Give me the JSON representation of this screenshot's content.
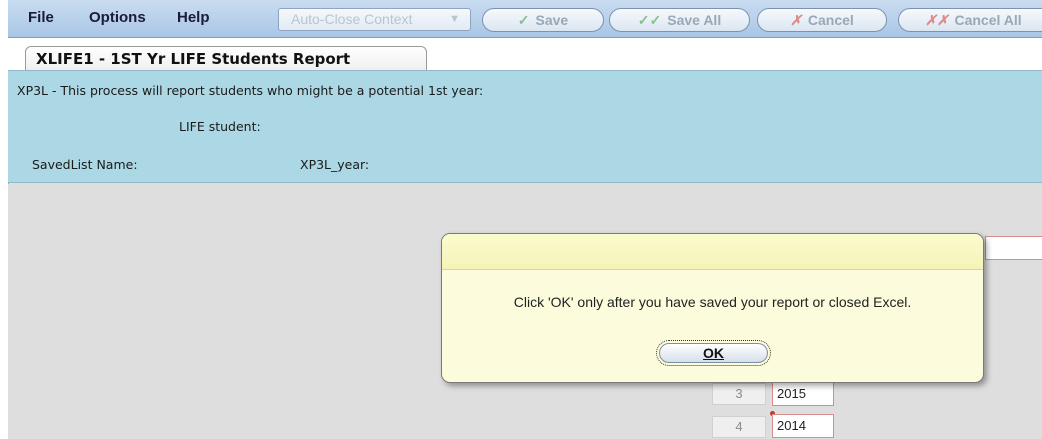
{
  "menu": {
    "file": "File",
    "options": "Options",
    "help": "Help"
  },
  "toolbar": {
    "context_dropdown": "Auto-Close Context",
    "save": "Save",
    "save_all": "Save All",
    "cancel": "Cancel",
    "cancel_all": "Cancel All"
  },
  "tab": {
    "title": "XLIFE1 - 1ST Yr LIFE Students Report"
  },
  "info": {
    "line1": "XP3L - This process will report students who might be a potential 1st year:",
    "line2": "LIFE student:",
    "savedlist_label": "SavedList Name:",
    "year_label": "XP3L_year:"
  },
  "list": {
    "rows": [
      {
        "num": "3",
        "value": "2015"
      },
      {
        "num": "4",
        "value": "2014"
      }
    ]
  },
  "dialog": {
    "message": "Click 'OK' only after you have saved your report or closed Excel.",
    "ok": "OK"
  },
  "colors": {
    "info_bg": "#acd8e6",
    "dialog_bg": "#fcfcdc",
    "menubar": "#b9d1ec"
  }
}
